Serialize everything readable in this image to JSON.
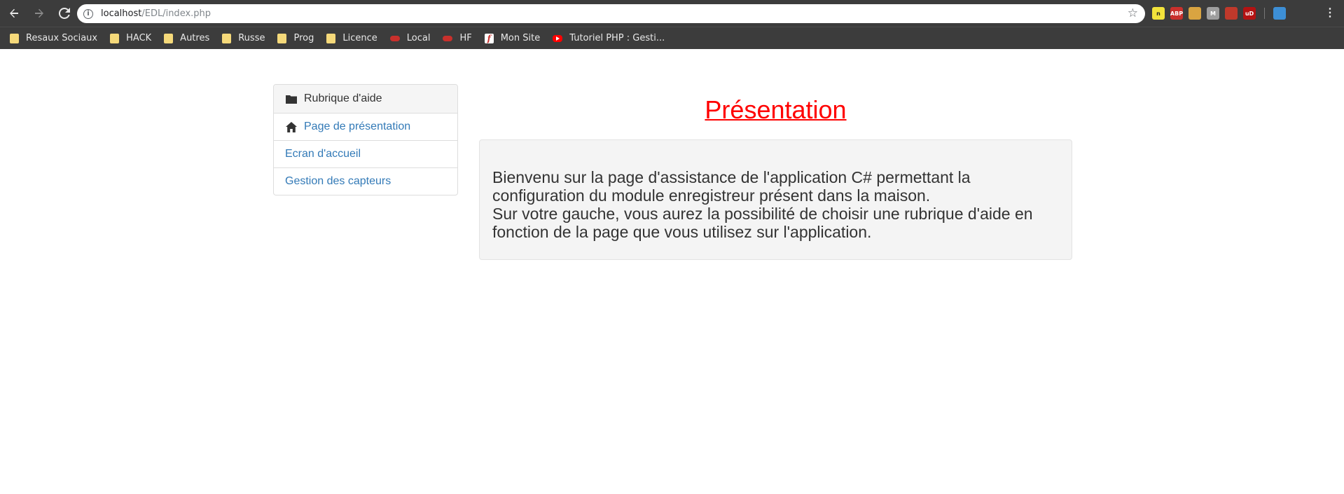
{
  "browser": {
    "url_host": "localhost",
    "url_path": "/EDL/index.php",
    "bookmarks": [
      {
        "label": "Resaux Sociaux",
        "icon": "folder-icon"
      },
      {
        "label": "HACK",
        "icon": "folder-icon"
      },
      {
        "label": "Autres",
        "icon": "folder-icon"
      },
      {
        "label": "Russe",
        "icon": "folder-icon"
      },
      {
        "label": "Prog",
        "icon": "folder-icon"
      },
      {
        "label": "Licence",
        "icon": "folder-icon"
      },
      {
        "label": "Local",
        "icon": "server-icon"
      },
      {
        "label": "HF",
        "icon": "server-icon"
      },
      {
        "label": "Mon Site",
        "icon": "site-f-icon"
      },
      {
        "label": "Tutoriel PHP : Gesti...",
        "icon": "youtube-icon"
      }
    ],
    "extensions": [
      {
        "name": "note-extension-icon",
        "label": "n",
        "color": "#f2e33b"
      },
      {
        "name": "adblock-extension-icon",
        "label": "ABP",
        "color": "#c9302c"
      },
      {
        "name": "cookie-extension-icon",
        "label": "",
        "color": "#d9a441"
      },
      {
        "name": "m-extension-icon",
        "label": "M",
        "color": "#9e9e9e"
      },
      {
        "name": "pdf-extension-icon",
        "label": "",
        "color": "#c0392b"
      },
      {
        "name": "ublock-extension-icon",
        "label": "uD",
        "color": "#b31212"
      },
      {
        "name": "vpn-extension-icon",
        "label": "",
        "color": "#3d8fd6"
      }
    ]
  },
  "sidebar": {
    "header": "Rubrique d'aide",
    "items": [
      {
        "label": "Page de présentation"
      },
      {
        "label": "Ecran d'accueil"
      },
      {
        "label": "Gestion des capteurs"
      }
    ]
  },
  "main": {
    "title": "Présentation",
    "paragraph_1": "Bienvenu sur la page d'assistance de l'application C# permettant la configuration du module enregistreur présent dans la maison.",
    "paragraph_2": "Sur votre gauche, vous aurez la possibilité de choisir une rubrique d'aide en fonction de la page que vous utilisez sur l'application."
  },
  "colors": {
    "title": "#ff0000",
    "link": "#337ab7",
    "panel_bg": "#f4f4f4",
    "chrome_bg": "#3c3c3c"
  }
}
